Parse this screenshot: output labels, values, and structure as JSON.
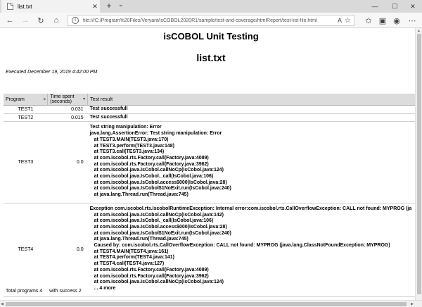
{
  "browser": {
    "tab_title": "list.txt",
    "tab_close": "✕",
    "new_tab": "+",
    "tab_menu": "⌄",
    "window_controls": [
      "—",
      "☐",
      "✕"
    ],
    "url": "file:///C:/Program%20Files/Veryant/isCOBOL2020R1/sample/test-and-coverage/htmlReport/test-list-file.html",
    "icons": [
      "back-icon",
      "forward-icon",
      "refresh-icon",
      "home-icon",
      "info-icon",
      "reader-icon",
      "favorite-icon",
      "favorites-bar-icon",
      "collections-icon",
      "profile-icon",
      "more-icon"
    ]
  },
  "page": {
    "app_title": "isCOBOL Unit Testing",
    "file_title": "list.txt",
    "executed": "Executed December 19, 2019 4:42:00 PM"
  },
  "table": {
    "headers": [
      "Program",
      "Time spent (seconds)",
      "Test result"
    ],
    "rows": [
      {
        "program": "TEST1",
        "time": "0.031",
        "result": [
          "Test successfull"
        ]
      },
      {
        "program": "TEST2",
        "time": "0.015",
        "result": [
          "Test successfull"
        ]
      },
      {
        "program": "TEST3",
        "time": "0.0",
        "result": [
          "Test string manipulation: Error",
          "java.lang.AssertionError: Test string manipulation: Error",
          "at TEST3.MAIN(TEST3.java:170)",
          "at TEST3.perform(TEST3.java:148)",
          "at TEST3.call(TEST3.java:134)",
          "at com.iscobol.rts.Factory.call(Factory.java:4089)",
          "at com.iscobol.rts.Factory.call(Factory.java:3962)",
          "at com.iscobol.java.IsCobol.callNoCp(IsCobol.java:124)",
          "at com.iscobol.java.IsCobol._call(IsCobol.java:106)",
          "at com.iscobol.java.IsCobol.access$000(IsCobol.java:28)",
          "at com.iscobol.java.IsCobol$1NoExit.run(IsCobol.java:240)",
          "at java.lang.Thread.run(Thread.java:745)"
        ]
      },
      {
        "program": "TEST4",
        "time": "0.0",
        "result": [
          "Exception com.iscobol.rts.IscobolRuntimeException: Internal error:com.iscobol.rts.CallOverflowException: CALL not found: MYPROG (ja",
          "at com.iscobol.java.IsCobol.callNoCp(IsCobol.java:142)",
          "at com.iscobol.java.IsCobol._call(IsCobol.java:106)",
          "at com.iscobol.java.IsCobol.access$000(IsCobol.java:28)",
          "at com.iscobol.java.IsCobol$1NoExit.run(IsCobol.java:240)",
          "at java.lang.Thread.run(Thread.java:745)",
          "Caused by: com.iscobol.rts.CallOverflowException: CALL not found: MYPROG (java.lang.ClassNotFoundException: MYPROG)",
          "at TEST4.MAIN(TEST4.java:161)",
          "at TEST4.perform(TEST4.java:141)",
          "at TEST4.call(TEST4.java:127)",
          "at com.iscobol.rts.Factory.call(Factory.java:4089)",
          "at com.iscobol.rts.Factory.call(Factory.java:3962)",
          "at com.iscobol.java.IsCobol.callNoCp(IsCobol.java:124)",
          "... 4 more"
        ]
      }
    ],
    "indent_flags": {
      "TEST3": [
        false,
        false,
        true,
        true,
        true,
        true,
        true,
        true,
        true,
        true,
        true,
        true
      ],
      "TEST4": [
        false,
        true,
        true,
        true,
        true,
        true,
        true,
        true,
        true,
        true,
        true,
        true,
        true,
        true
      ]
    }
  },
  "summary": {
    "total": "Total programs 4",
    "success": "with success 2"
  }
}
